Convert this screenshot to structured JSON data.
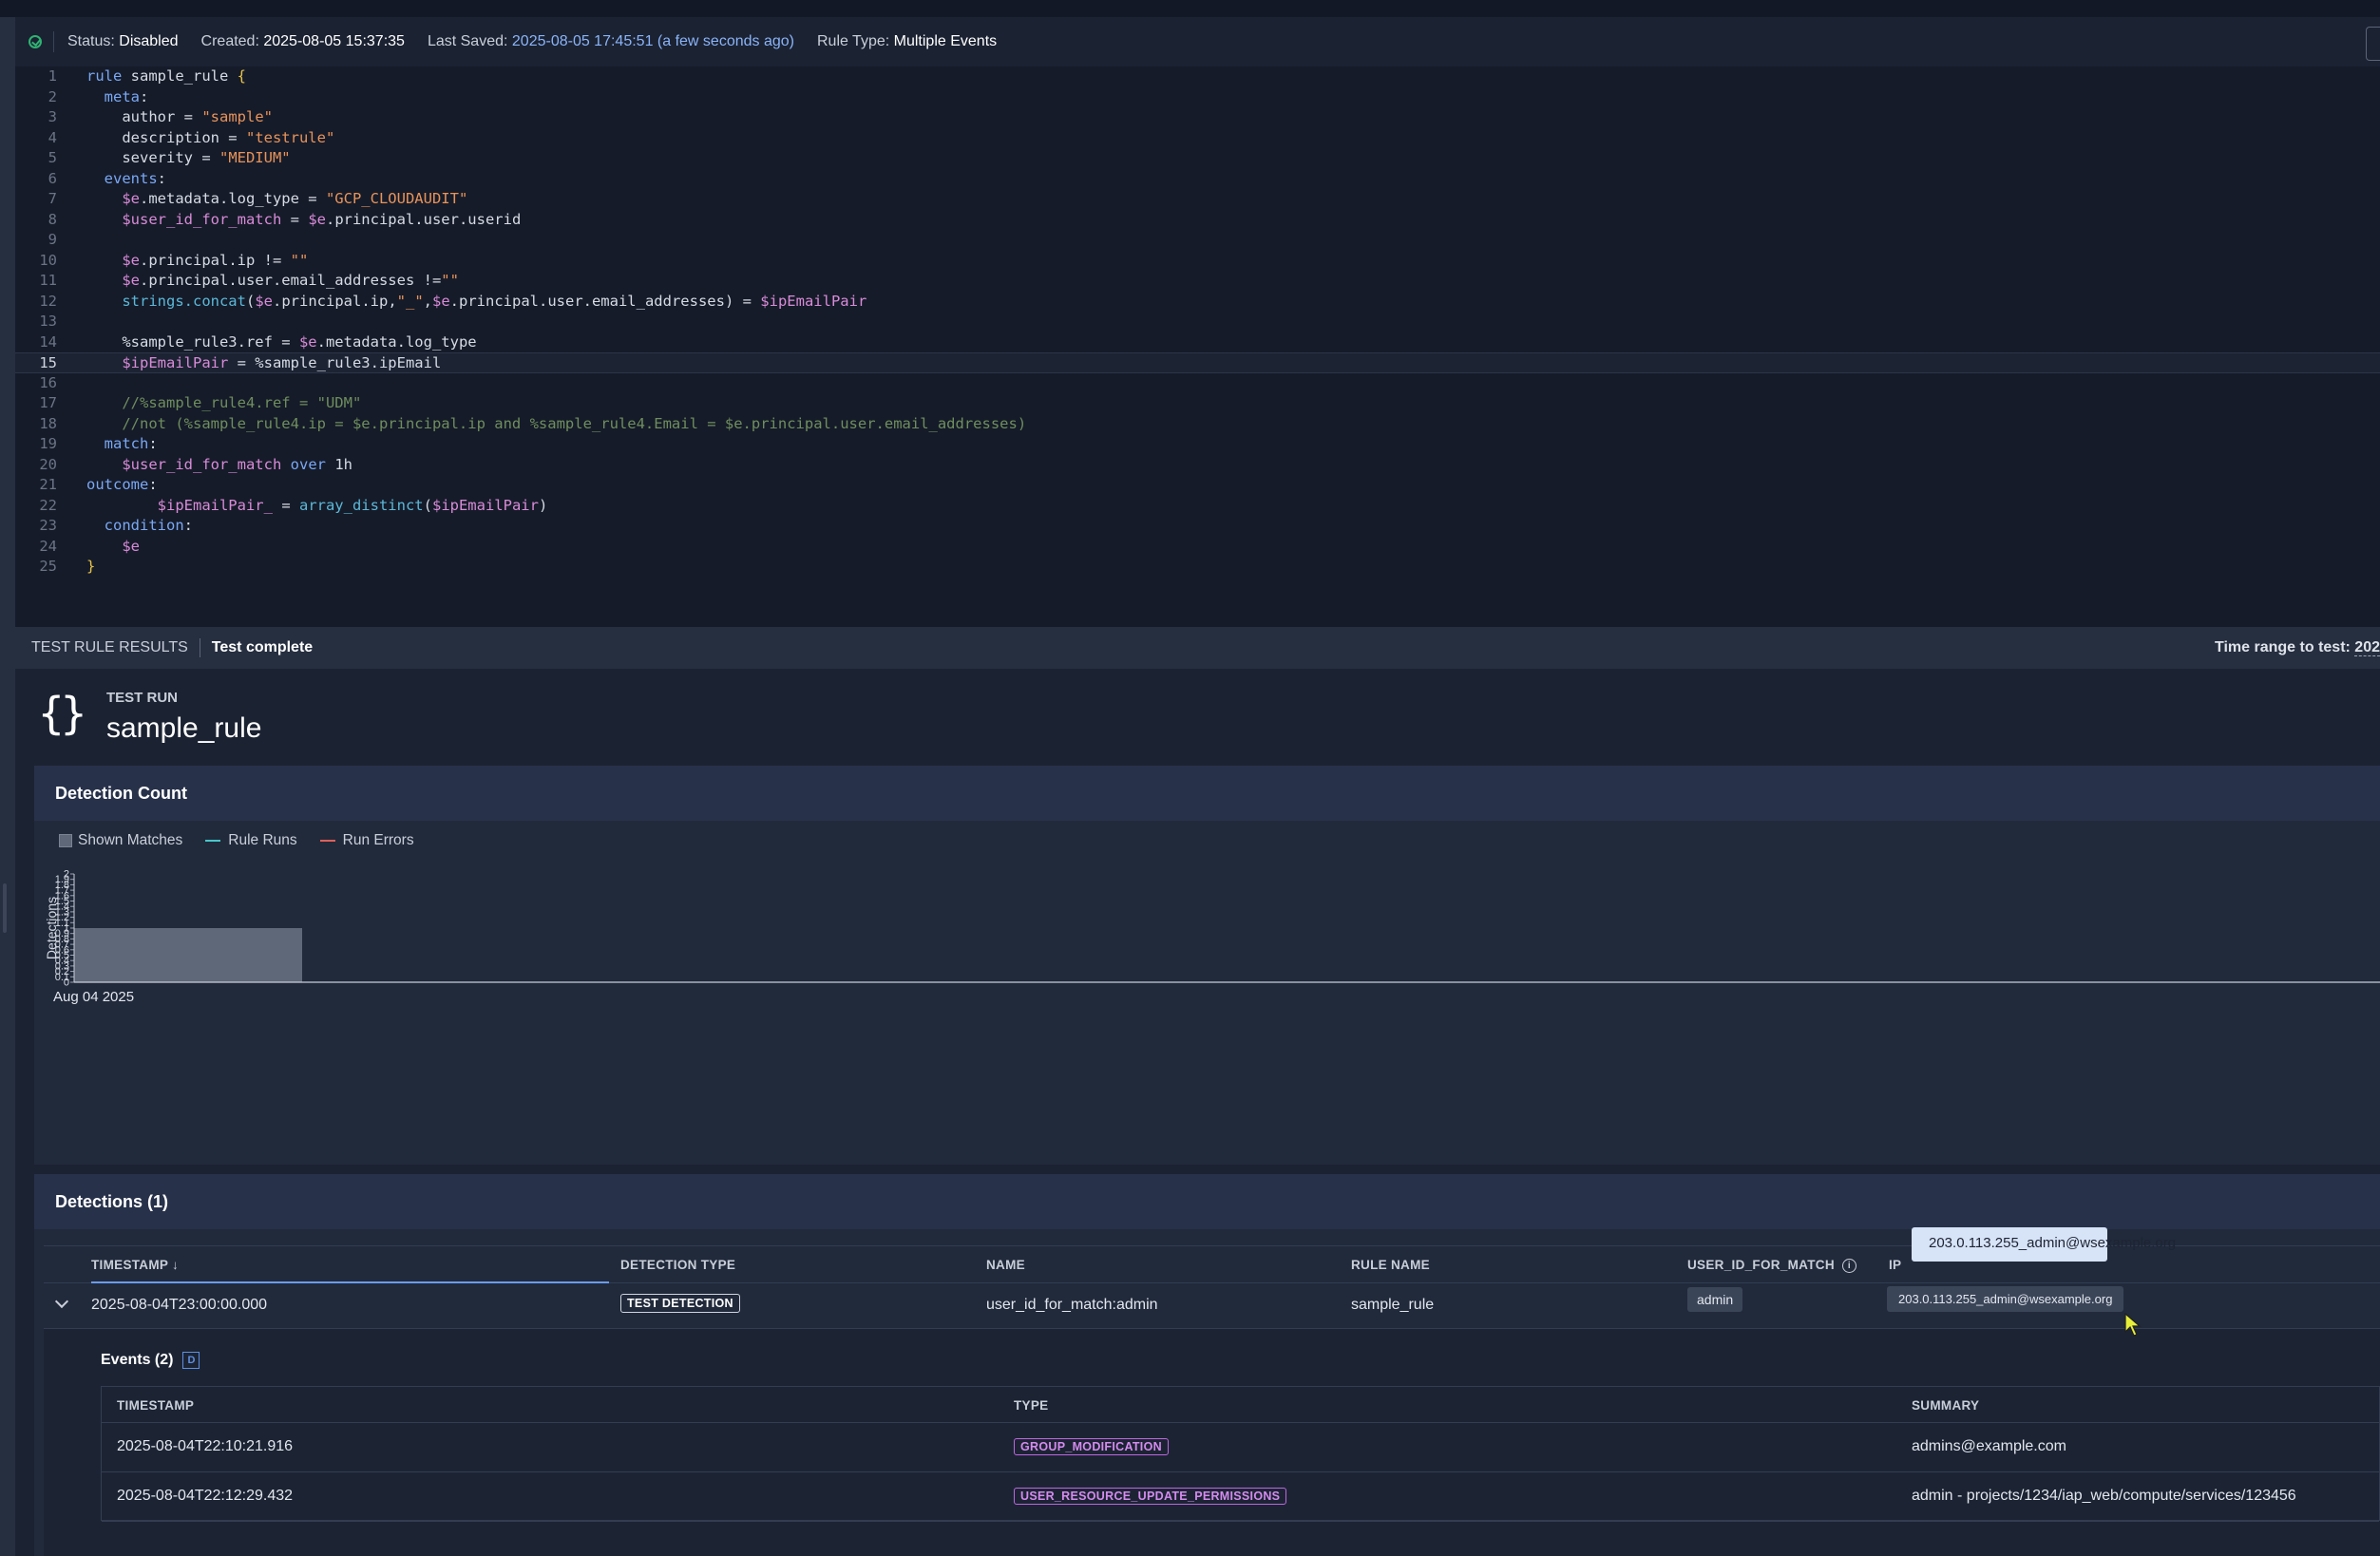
{
  "status_bar": {
    "status_label": "Status:",
    "status_value": "Disabled",
    "created_label": "Created:",
    "created_value": "2025-08-05 15:37:35",
    "saved_label": "Last Saved:",
    "saved_value": "2025-08-05 17:45:51 (a few seconds ago)",
    "rule_type_label": "Rule Type:",
    "rule_type_value": "Multiple Events"
  },
  "editor": {
    "active_line": 15,
    "line_numbers": [
      "1",
      "2",
      "3",
      "4",
      "5",
      "6",
      "7",
      "8",
      "9",
      "10",
      "11",
      "12",
      "13",
      "14",
      "15",
      "16",
      "17",
      "18",
      "19",
      "20",
      "21",
      "22",
      "23",
      "24",
      "25"
    ]
  },
  "results_bar": {
    "title": "TEST RULE RESULTS",
    "status": "Test complete",
    "time_range_label": "Time range to test:",
    "time_range_value": "202"
  },
  "test_run": {
    "caption": "TEST RUN",
    "rule_name": "sample_rule"
  },
  "detection_count": {
    "title": "Detection Count",
    "legend": {
      "shown_matches": "Shown Matches",
      "rule_runs": "Rule Runs",
      "run_errors": "Run Errors"
    },
    "colors": {
      "shown_matches": "#5f6878",
      "rule_runs": "#48c7c9",
      "run_errors": "#e0605a"
    }
  },
  "chart_data": {
    "type": "bar",
    "categories": [
      "Aug 04 2025"
    ],
    "values": [
      1
    ],
    "ylabel": "Detections",
    "ylim": [
      0,
      2
    ],
    "yticks": [
      "0",
      "0.1",
      "0.2",
      "0.3",
      "0.4",
      "0.5",
      "0.6",
      "0.7",
      "0.8",
      "0.9",
      "1",
      "1.1",
      "1.2",
      "1.3",
      "1.4",
      "1.5",
      "1.6",
      "1.7",
      "1.8",
      "1.9",
      "2"
    ],
    "legend": [
      "Shown Matches",
      "Rule Runs",
      "Run Errors"
    ],
    "legend_position": "top-left"
  },
  "detections": {
    "title": "Detections (1)",
    "columns": {
      "timestamp": "TIMESTAMP ↓",
      "detection_type": "DETECTION TYPE",
      "name": "NAME",
      "rule_name": "RULE NAME",
      "user_id_for_match": "USER_ID_FOR_MATCH",
      "ip": "IP"
    },
    "row": {
      "timestamp": "2025-08-04T23:00:00.000",
      "detection_type": "TEST DETECTION",
      "name": "user_id_for_match:admin",
      "rule_name": "sample_rule",
      "user_id_for_match": "admin",
      "ip_email": "203.0.113.255_admin@wsexample.org"
    },
    "tooltip": "203.0.113.255_admin@wsexample.org",
    "events": {
      "title": "Events (2)",
      "badge": "D",
      "columns": {
        "timestamp": "TIMESTAMP",
        "type": "TYPE",
        "summary": "SUMMARY"
      },
      "rows": [
        {
          "timestamp": "2025-08-04T22:10:21.916",
          "type": "GROUP_MODIFICATION",
          "summary": "admins@example.com"
        },
        {
          "timestamp": "2025-08-04T22:12:29.432",
          "type": "USER_RESOURCE_UPDATE_PERMISSIONS",
          "summary": "admin - projects/1234/iap_web/compute/services/123456"
        }
      ]
    }
  }
}
